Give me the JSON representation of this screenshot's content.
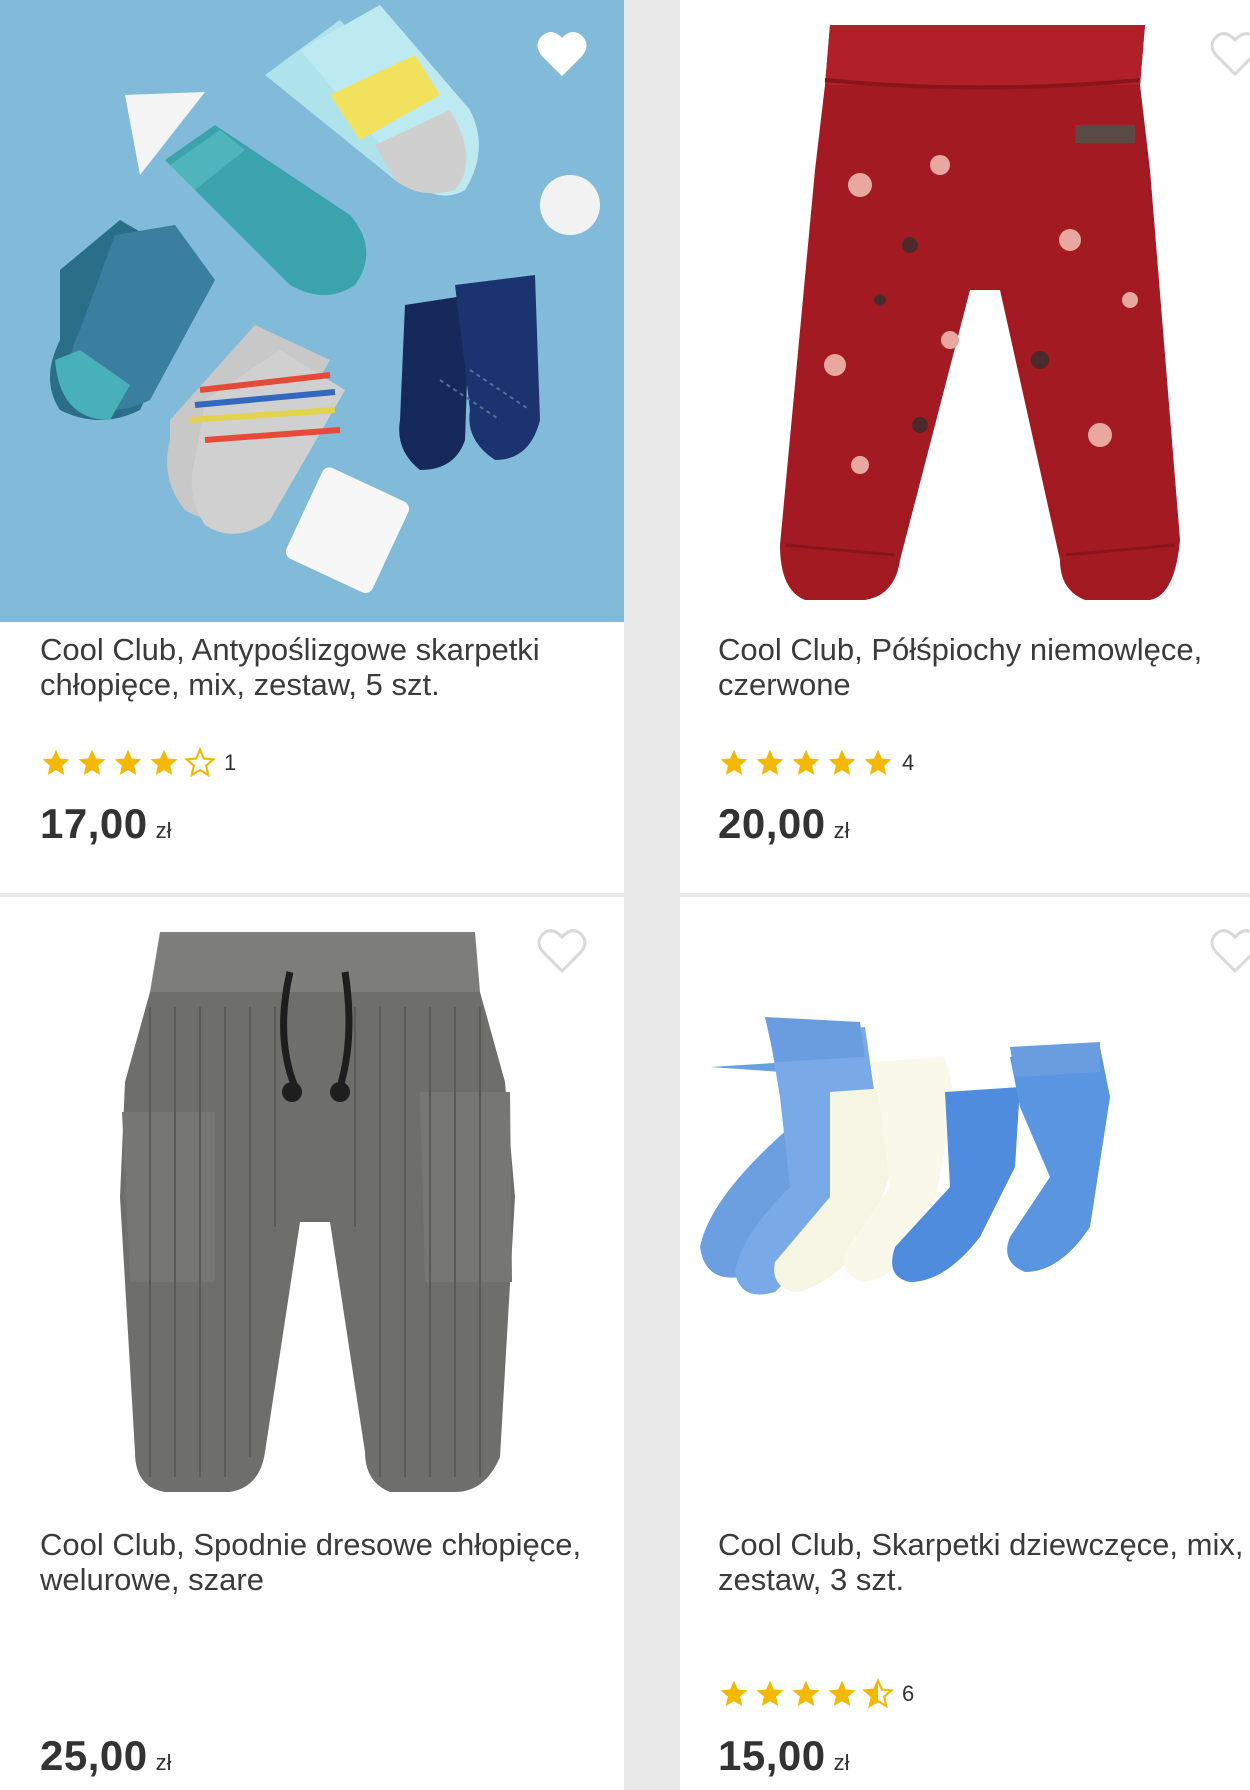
{
  "products": [
    {
      "title": "Cool Club, Antypoślizgowe skarpetki chłopięce, mix, zestaw, 5 szt.",
      "rating_count": "1",
      "rating": 4,
      "price": "17,00",
      "currency": "zł",
      "favorited": true
    },
    {
      "title": "Cool Club, Półśpiochy niemowlęce, czerwone",
      "rating_count": "4",
      "rating": 5,
      "price": "20,00",
      "currency": "zł",
      "favorited": false
    },
    {
      "title": "Cool Club, Spodnie dresowe chłopięce, welurowe, szare",
      "price": "25,00",
      "currency": "zł",
      "favorited": false
    },
    {
      "title": "Cool Club, Skarpetki dziewczęce, mix, zestaw, 3 szt.",
      "rating_count": "6",
      "rating": 4.5,
      "price": "15,00",
      "currency": "zł",
      "favorited": false
    }
  ],
  "colors": {
    "star": "#f5b800",
    "heart_outline": "#d9d9d9",
    "heart_filled": "#ffffff",
    "sock_bg": "#7fb8d8"
  }
}
